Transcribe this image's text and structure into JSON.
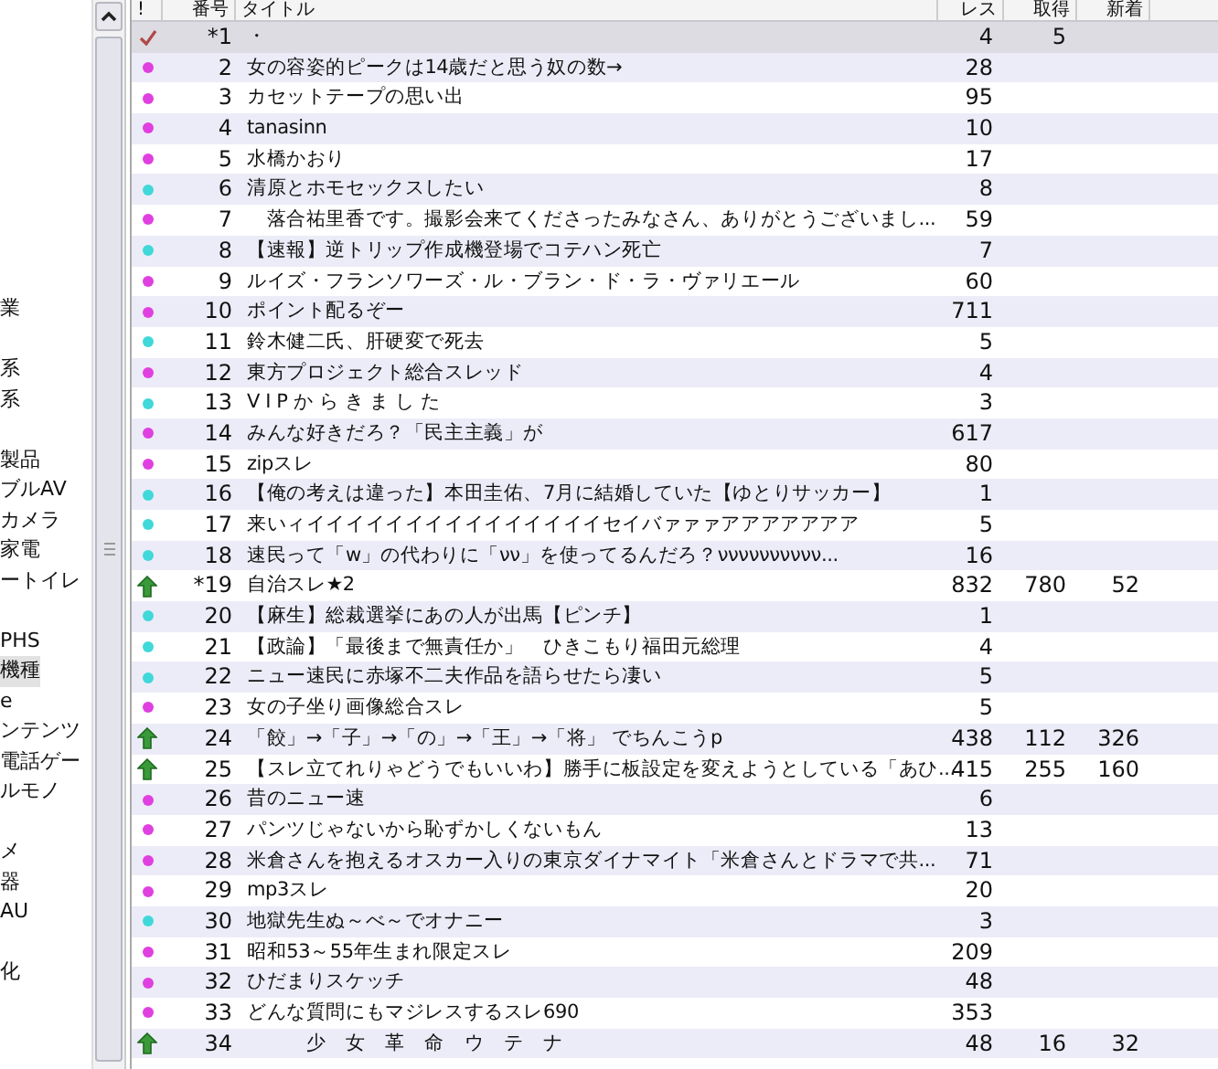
{
  "board_tree": {
    "groups": [
      {
        "items": [
          {
            "label": "業",
            "selected": false
          }
        ]
      },
      {
        "items": [
          {
            "label": "系",
            "selected": false
          },
          {
            "label": "系",
            "selected": false
          }
        ]
      },
      {
        "items": [
          {
            "label": "製品",
            "selected": false
          },
          {
            "label": "ブルAV",
            "selected": false
          },
          {
            "label": "カメラ",
            "selected": false
          },
          {
            "label": "家電",
            "selected": false
          },
          {
            "label": "ートイレ",
            "selected": false
          }
        ]
      },
      {
        "items": [
          {
            "label": "PHS",
            "selected": false
          },
          {
            "label": "機種",
            "selected": true
          },
          {
            "label": "e",
            "selected": false
          },
          {
            "label": "ンテンツ",
            "selected": false
          },
          {
            "label": "電話ゲー",
            "selected": false
          },
          {
            "label": "ルモノ",
            "selected": false
          }
        ]
      },
      {
        "items": [
          {
            "label": "メ",
            "selected": false
          },
          {
            "label": "器",
            "selected": false
          },
          {
            "label": "AU",
            "selected": false
          }
        ]
      },
      {
        "items": [
          {
            "label": "化",
            "selected": false
          }
        ]
      }
    ]
  },
  "thread_list": {
    "columns": [
      "!",
      "番号",
      "タイトル",
      "レス",
      "取得",
      "新着"
    ],
    "rows": [
      {
        "kind": "check",
        "number": "*1",
        "title": "・",
        "res": "4",
        "fetched": "5",
        "new": "",
        "selected": true
      },
      {
        "kind": "dot",
        "color": "#e040e0",
        "number": "2",
        "title": "女の容姿的ピークは14歳だと思う奴の数→",
        "res": "28",
        "selected": false
      },
      {
        "kind": "dot",
        "color": "#e040e0",
        "number": "3",
        "title": "カセットテープの思い出",
        "res": "95",
        "selected": false
      },
      {
        "kind": "dot",
        "color": "#e040e0",
        "number": "4",
        "title": "tanasinn",
        "res": "10",
        "selected": false
      },
      {
        "kind": "dot",
        "color": "#e040e0",
        "number": "5",
        "title": "水橋かおり",
        "res": "17",
        "selected": false
      },
      {
        "kind": "dot",
        "color": "#40d8d8",
        "number": "6",
        "title": "清原とホモセックスしたい",
        "res": "8",
        "selected": false
      },
      {
        "kind": "dot",
        "color": "#e040e0",
        "number": "7",
        "title": "　落合祐里香です。撮影会来てくださったみなさん、ありがとうございまし...",
        "res": "59",
        "selected": false
      },
      {
        "kind": "dot",
        "color": "#40d8d8",
        "number": "8",
        "title": "【速報】逆トリップ作成機登場でコテハン死亡",
        "res": "7",
        "selected": false
      },
      {
        "kind": "dot",
        "color": "#e040e0",
        "number": "9",
        "title": "ルイズ・フランソワーズ・ル・ブラン・ド・ラ・ヴァリエール",
        "res": "60",
        "selected": false
      },
      {
        "kind": "dot",
        "color": "#e040e0",
        "number": "10",
        "title": "ポイント配るぞー",
        "res": "711",
        "selected": false
      },
      {
        "kind": "dot",
        "color": "#40d8d8",
        "number": "11",
        "title": "鈴木健二氏、肝硬変で死去",
        "res": "5",
        "selected": false
      },
      {
        "kind": "dot",
        "color": "#e040e0",
        "number": "12",
        "title": "東方プロジェクト総合スレッド",
        "res": "4",
        "selected": false
      },
      {
        "kind": "dot",
        "color": "#40d8d8",
        "number": "13",
        "title": "V I P か ら き ま し た",
        "res": "3",
        "selected": false
      },
      {
        "kind": "dot",
        "color": "#e040e0",
        "number": "14",
        "title": "みんな好きだろ？「民主主義」が",
        "res": "617",
        "selected": false
      },
      {
        "kind": "dot",
        "color": "#e040e0",
        "number": "15",
        "title": "zipスレ",
        "res": "80",
        "selected": false
      },
      {
        "kind": "dot",
        "color": "#40d8d8",
        "number": "16",
        "title": "【俺の考えは違った】本田圭佑、7月に結婚していた【ゆとりサッカー】",
        "res": "1",
        "selected": false
      },
      {
        "kind": "dot",
        "color": "#40d8d8",
        "number": "17",
        "title": "来いィイイイイイイイイイイイイイイイセイバァァァアアアアアアア",
        "res": "5",
        "selected": false
      },
      {
        "kind": "dot",
        "color": "#40d8d8",
        "number": "18",
        "title": "速民って「w」の代わりに「νν」を使ってるんだろ？νννννννννν...",
        "res": "16",
        "selected": false
      },
      {
        "kind": "update",
        "number": "*19",
        "title": "自治スレ★2",
        "res": "832",
        "fetched": "780",
        "new": "52",
        "selected": false
      },
      {
        "kind": "dot",
        "color": "#40d8d8",
        "number": "20",
        "title": "【麻生】総裁選挙にあの人が出馬【ピンチ】",
        "res": "1",
        "selected": false
      },
      {
        "kind": "dot",
        "color": "#40d8d8",
        "number": "21",
        "title": "【政論】「最後まで無責任か」　ひきこもり福田元総理",
        "res": "4",
        "selected": false
      },
      {
        "kind": "dot",
        "color": "#40d8d8",
        "number": "22",
        "title": "ニュー速民に赤塚不二夫作品を語らせたら凄い",
        "res": "5",
        "selected": false
      },
      {
        "kind": "dot",
        "color": "#e040e0",
        "number": "23",
        "title": "女の子坐り画像総合スレ",
        "res": "5",
        "selected": false
      },
      {
        "kind": "update",
        "number": "24",
        "title": "「餃」→「子」→「の」→「王」→「将」 でちんこうp",
        "res": "438",
        "fetched": "112",
        "new": "326",
        "selected": false
      },
      {
        "kind": "update",
        "number": "25",
        "title": "【スレ立てれりゃどうでもいいわ】勝手に板設定を変えようとしている「あひ...",
        "res": "415",
        "fetched": "255",
        "new": "160",
        "selected": false
      },
      {
        "kind": "dot",
        "color": "#e040e0",
        "number": "26",
        "title": "昔のニュー速",
        "res": "6",
        "selected": false
      },
      {
        "kind": "dot",
        "color": "#e040e0",
        "number": "27",
        "title": "パンツじゃないから恥ずかしくないもん",
        "res": "13",
        "selected": false
      },
      {
        "kind": "dot",
        "color": "#e040e0",
        "number": "28",
        "title": "米倉さんを抱えるオスカー入りの東京ダイナマイト「米倉さんとドラマで共...",
        "res": "71",
        "selected": false
      },
      {
        "kind": "dot",
        "color": "#e040e0",
        "number": "29",
        "title": "mp3スレ",
        "res": "20",
        "selected": false
      },
      {
        "kind": "dot",
        "color": "#40d8d8",
        "number": "30",
        "title": "地獄先生ぬ～べ～でオナニー",
        "res": "3",
        "selected": false
      },
      {
        "kind": "dot",
        "color": "#e040e0",
        "number": "31",
        "title": "昭和53～55年生まれ限定スレ",
        "res": "209",
        "selected": false
      },
      {
        "kind": "dot",
        "color": "#e040e0",
        "number": "32",
        "title": "ひだまりスケッチ",
        "res": "48",
        "selected": false
      },
      {
        "kind": "dot",
        "color": "#e040e0",
        "number": "33",
        "title": "どんな質問にもマジレスするスレ690",
        "res": "353",
        "selected": false
      },
      {
        "kind": "update",
        "number": "34",
        "title": "　　　少　女　革　命　ウ　テ　ナ",
        "res": "48",
        "fetched": "16",
        "new": "32",
        "selected": false
      }
    ]
  }
}
